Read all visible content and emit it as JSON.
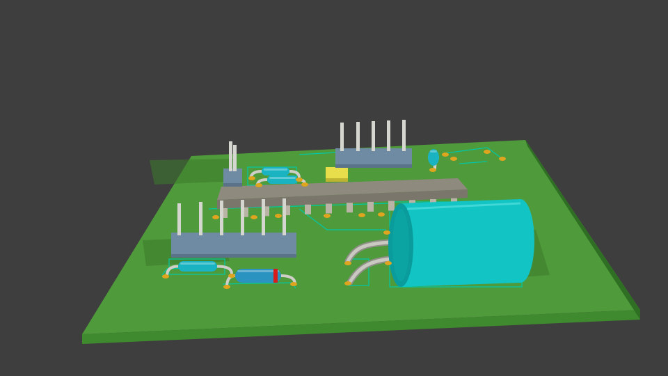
{
  "scene": {
    "background_color": "#3e3e3e",
    "board": {
      "top_color": "#4f9a3a",
      "front_edge_color": "#3f8a2e",
      "side_edge_color": "#2f6f24",
      "trace_color": "#00c8a8"
    },
    "components": [
      {
        "name": "pin-header-6",
        "body_color": "#6f8ba3",
        "pin_color": "#d6d6d0",
        "pin_count": 6
      },
      {
        "name": "pin-header-5",
        "body_color": "#6f8ba3",
        "pin_color": "#d6d6d0",
        "pin_count": 5
      },
      {
        "name": "pin-header-2",
        "body_color": "#6f8ba3",
        "pin_color": "#d6d6d0",
        "pin_count": 2
      },
      {
        "name": "dip-ic",
        "body_color": "#8e8a7e",
        "pin_color": "#b9b4a6"
      },
      {
        "name": "electrolytic-capacitor",
        "body_color": "#12c4c4"
      },
      {
        "name": "crystal",
        "body_color": "#e8dd4a"
      },
      {
        "name": "axial-resistor",
        "body_color": "#1ab3c2"
      },
      {
        "name": "diode",
        "body_color": "#2a93bf",
        "band_color": "#d81c1c"
      },
      {
        "name": "solder-pad",
        "body_color": "#e0a51f"
      }
    ]
  }
}
